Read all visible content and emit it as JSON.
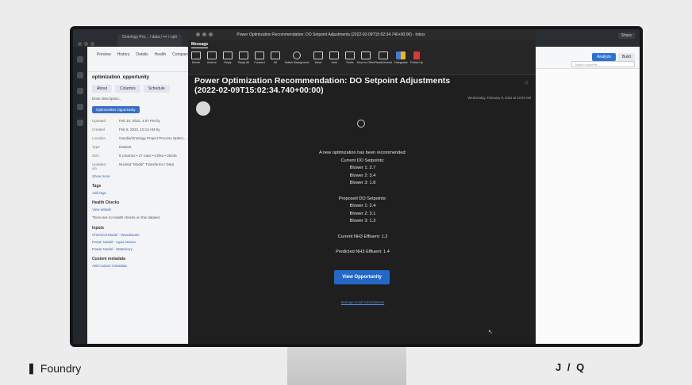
{
  "footer": {
    "brand": "Foundry",
    "brand_mark": "❚",
    "right_logo": "J / Q"
  },
  "background_app": {
    "tab_label": "Ontology Pro... / data / ••• / opti",
    "left_tabs": [
      "Preview",
      "History",
      "Details",
      "Health",
      "Compare"
    ],
    "title": "optimization_opportunity",
    "sub_tabs": [
      "About",
      "Columns",
      "Schedule"
    ],
    "description": "Enter description...",
    "badge": "Optimization Opportunity",
    "meta": [
      {
        "k": "Updated",
        "v": "Feb 10, 2022, 4:07 PM by"
      },
      {
        "k": "Created",
        "v": "Feb 6, 2022, 10:14 AM by"
      },
      {
        "k": "Location",
        "v": "/sandia/Ontology Project Process Optimi..."
      },
      {
        "k": "Type",
        "v": "Dataset"
      },
      {
        "k": "Size",
        "v": "8 columns • 27 rows • 5 files • 26445"
      },
      {
        "k": "Updated via",
        "v": "Nucleat \"Model\" Transforms / Data"
      }
    ],
    "show_more": "Show more",
    "tags_heading": "Tags",
    "add_tags": "Add tags",
    "health_heading": "Health Checks",
    "view_details": "View details",
    "health_text": "There are no health checks on this dataset.",
    "inputs_heading": "Inputs",
    "inputs": [
      "Chemical Model - Woodwaste",
      "Power Model - Agua Nueva",
      "Power Model - Waterbury"
    ],
    "custom_meta_heading": "Custom metadata",
    "add_custom": "Add custom metadata",
    "analyze": "Analyze",
    "build": "Build",
    "search_placeholder": "Search columns...",
    "top_right": [
      "Share"
    ]
  },
  "mail": {
    "window_title": "Power Optimization Recommendation: DO Setpoint Adjustments (2022-02-09T15:02:34.740+00:00) - Inbox",
    "ribbon_tab": "Message",
    "ribbon_buttons": [
      "Delete",
      "Archive",
      "Reply",
      "Reply All",
      "Forward",
      "IM",
      "Switch Background",
      "Move",
      "Junk",
      "Rules",
      "Move to Other",
      "Read/Unread",
      "Categorize",
      "Follow Up"
    ],
    "subject": "Power Optimization Recommendation: DO Setpoint Adjustments (2022-02-09T15:02:34.740+00:00)",
    "date": "Wednesday, February 9, 2022 at 10:03 AM",
    "intro": "A new optimization has been recommended:",
    "current_heading": "Current DO Setpoints:",
    "current": [
      "Blower 1: 2.7",
      "Blower 2: 3.4",
      "Blower 3: 1.8"
    ],
    "proposed_heading": "Proposed DO Setpoints:",
    "proposed": [
      "Blower 1: 2.4",
      "Blower 2: 3.1",
      "Blower 3: 1.3"
    ],
    "current_nh3": "Current NH3 Effluent: 1.2",
    "predicted_nh3": "Predicted NH3 Effluent: 1.4",
    "cta": "View Opportunity",
    "unsubscribe": "Manage email subscriptions"
  }
}
